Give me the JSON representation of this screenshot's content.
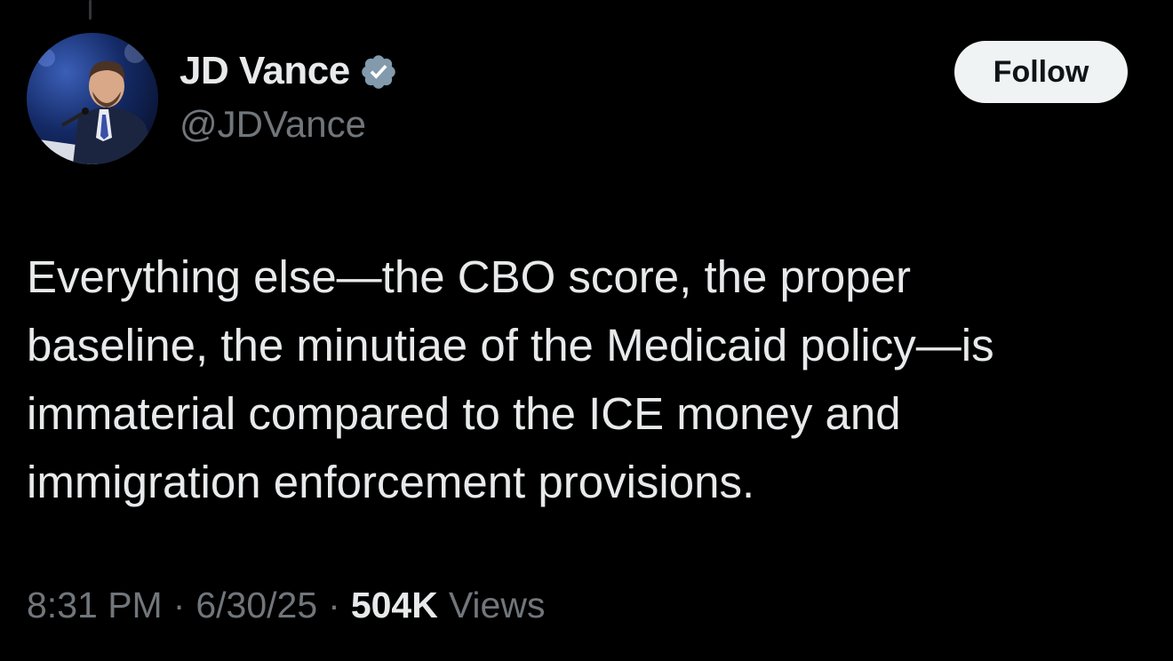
{
  "author": {
    "display_name": "JD Vance",
    "handle": "@JDVance",
    "avatar_icon": "profile-photo",
    "verified_icon": "verified-badge-icon",
    "verified_color": "#829aab"
  },
  "follow_button": {
    "label": "Follow"
  },
  "tweet": {
    "text": "Everything else—the CBO score, the proper\nbaseline, the minutiae of the Medicaid policy—is\nimmaterial compared to the ICE money and\nimmigration enforcement provisions."
  },
  "meta": {
    "time": "8:31 PM",
    "separator": "·",
    "date": "6/30/25",
    "views_count": "504K",
    "views_label": "Views"
  },
  "colors": {
    "background": "#000000",
    "primary_text": "#e7e9ea",
    "secondary_text": "#71767b",
    "button_bg": "#eff3f4",
    "button_text": "#0f1419"
  }
}
